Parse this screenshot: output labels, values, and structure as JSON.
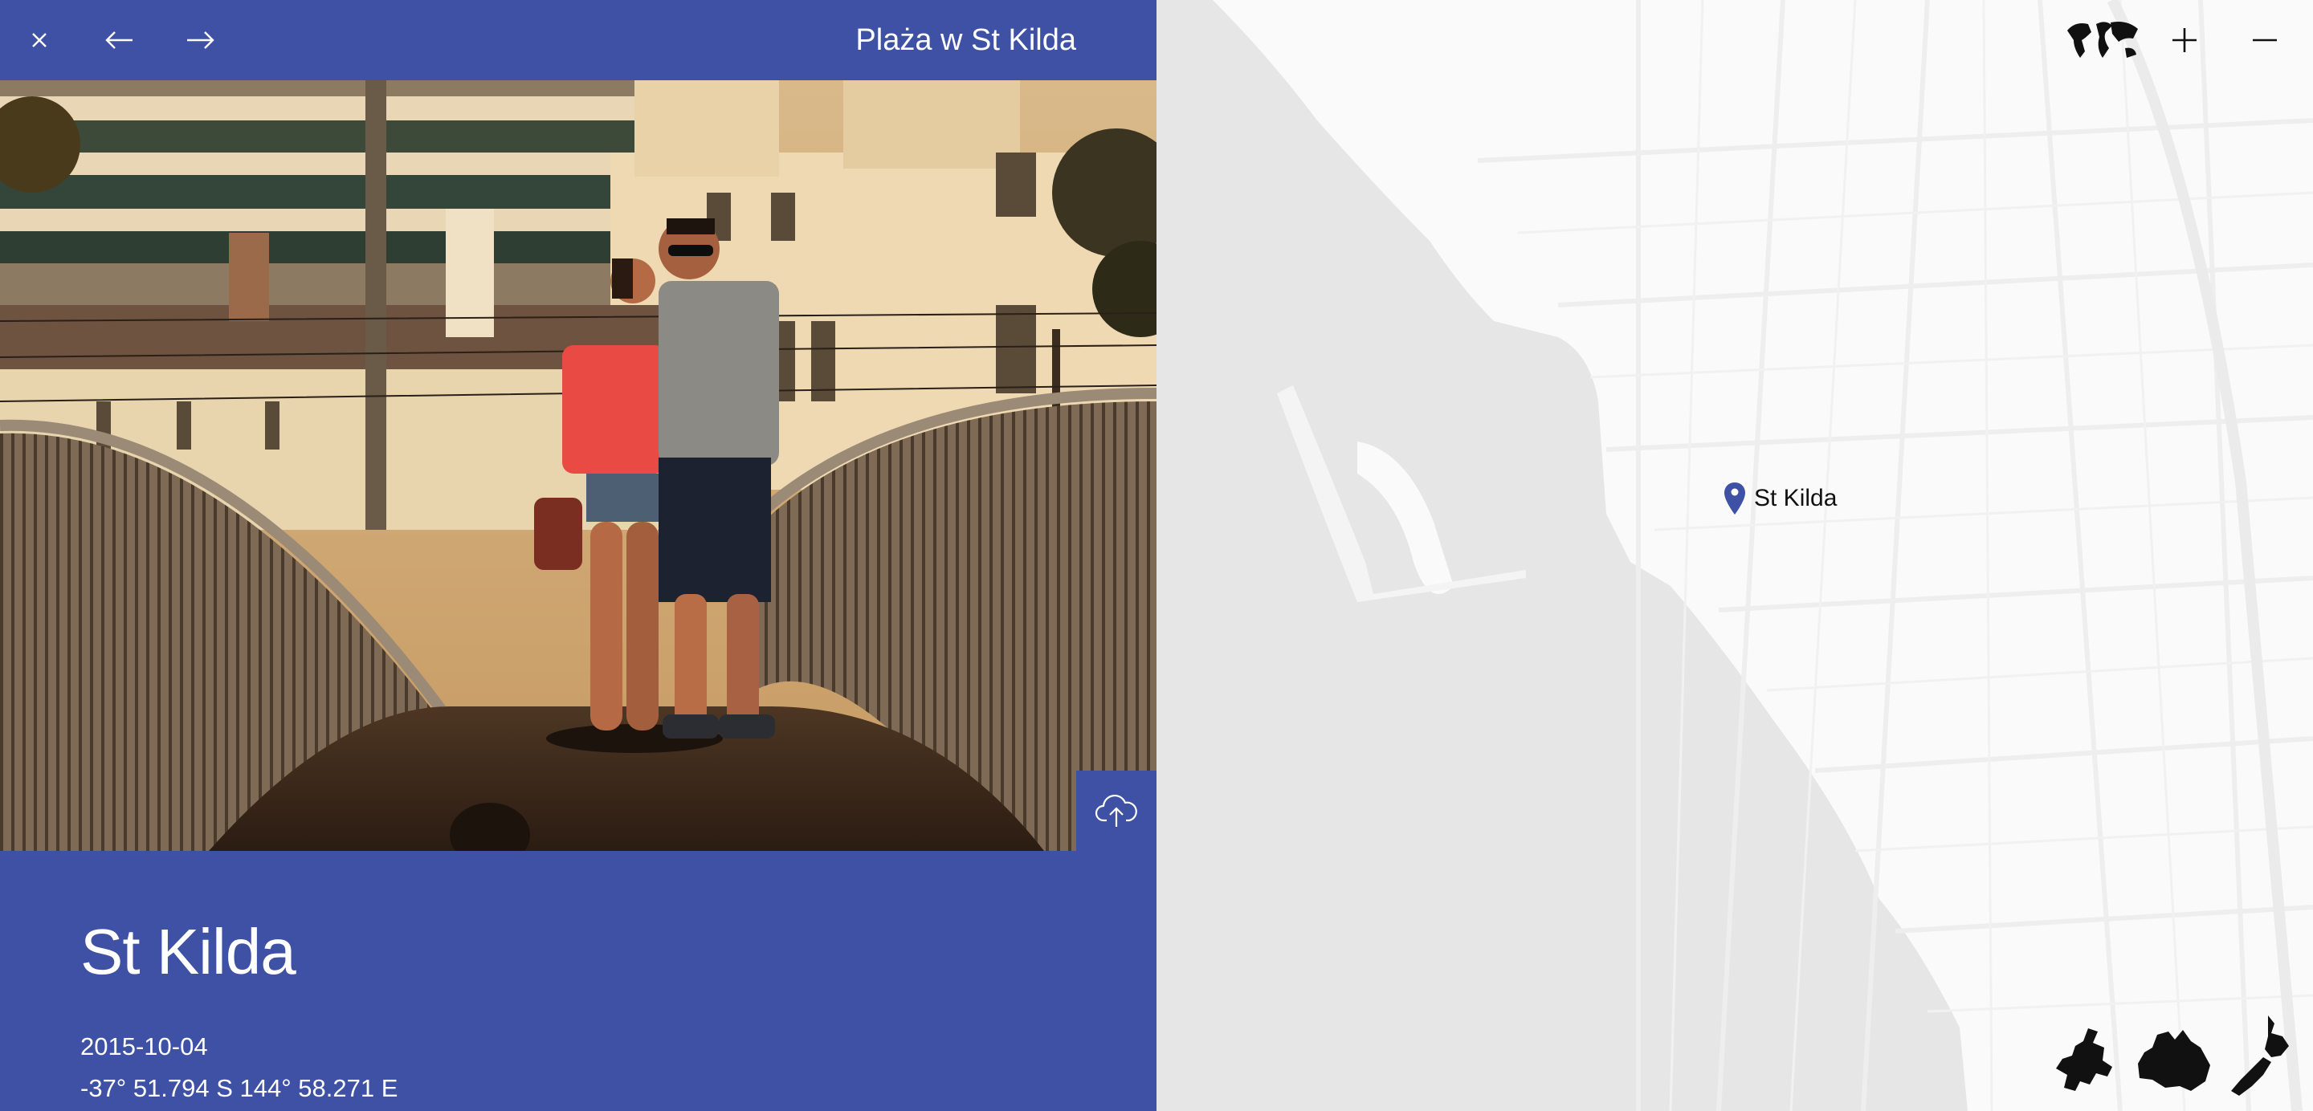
{
  "header": {
    "title": "Plaża w St Kilda",
    "close_icon": "close-icon",
    "back_icon": "arrow-left-icon",
    "forward_icon": "arrow-right-icon"
  },
  "photo": {
    "upload_icon": "cloud-upload-icon"
  },
  "details": {
    "title": "St Kilda",
    "date": "2015-10-04",
    "coordinates": "-37° 51.794 S 144° 58.271 E"
  },
  "map": {
    "marker_label": "St Kilda",
    "marker_icon": "map-pin-icon",
    "controls": [
      "world-map-icon",
      "zoom-in-icon",
      "zoom-out-icon"
    ],
    "continent_shortcuts": [
      "europe-icon",
      "australia-icon",
      "new-zealand-icon"
    ]
  },
  "colors": {
    "accent": "#3f51a5",
    "map_water": "#e6e6e6",
    "map_land": "#fafafa"
  }
}
